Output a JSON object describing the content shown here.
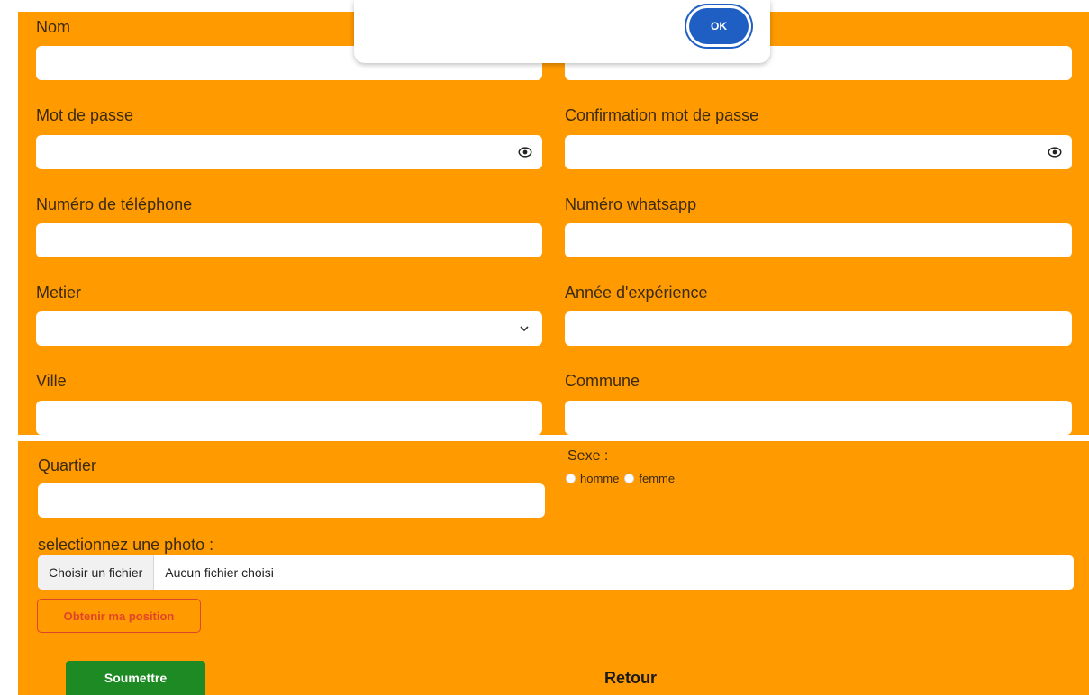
{
  "dialog": {
    "ok_label": "OK"
  },
  "form": {
    "nom_label": "Nom",
    "password_label": "Mot de passe",
    "confirm_password_label": "Confirmation mot de passe",
    "phone_label": "Numéro de téléphone",
    "whatsapp_label": "Numéro whatsapp",
    "metier_label": "Metier",
    "experience_label": "Année d'expérience",
    "ville_label": "Ville",
    "commune_label": "Commune",
    "quartier_label": "Quartier",
    "sexe_label": "Sexe :",
    "sexe_options": [
      "homme",
      "femme"
    ],
    "photo_label": "selectionnez une photo :",
    "file_button_label": "Choisir un fichier",
    "file_status": "Aucun fichier choisi",
    "position_button": "Obtenir ma position",
    "submit_button": "Soumettre",
    "back_link": "Retour"
  },
  "icons": {
    "eye": "eye-icon",
    "chevron": "chevron-down-icon"
  },
  "colors": {
    "background": "#ff9a00",
    "submit": "#1e8a23",
    "position_button": "#e0442a",
    "ok_button": "#1f5fc4"
  }
}
